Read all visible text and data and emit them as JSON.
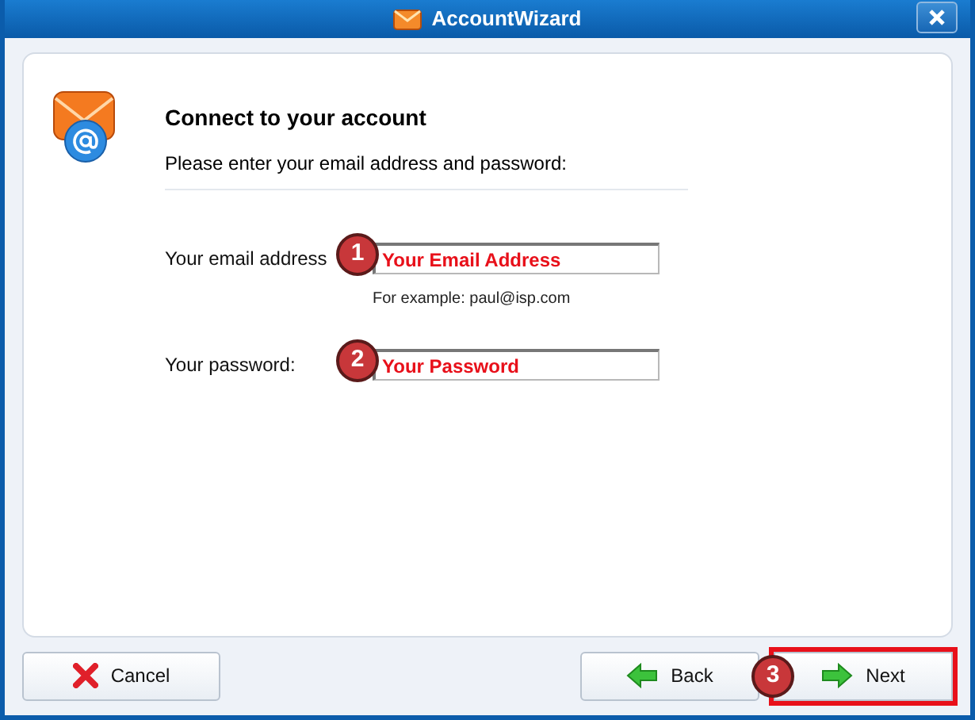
{
  "window": {
    "title": "AccountWizard"
  },
  "header": {
    "title": "Connect to your account",
    "subtitle": "Please enter your email address and password:"
  },
  "fields": [
    {
      "label": "Your email address",
      "badge": "1",
      "value": "Your Email Address",
      "hint": "For example: paul@isp.com"
    },
    {
      "label": "Your password:",
      "badge": "2",
      "value": "Your Password"
    }
  ],
  "buttons": [
    {
      "label": "Cancel",
      "kind": "cancel",
      "highlighted": false
    },
    {
      "label": "Back",
      "kind": "back",
      "highlighted": false
    },
    {
      "label": "Next",
      "kind": "next",
      "highlighted": true,
      "badge": "3"
    }
  ]
}
